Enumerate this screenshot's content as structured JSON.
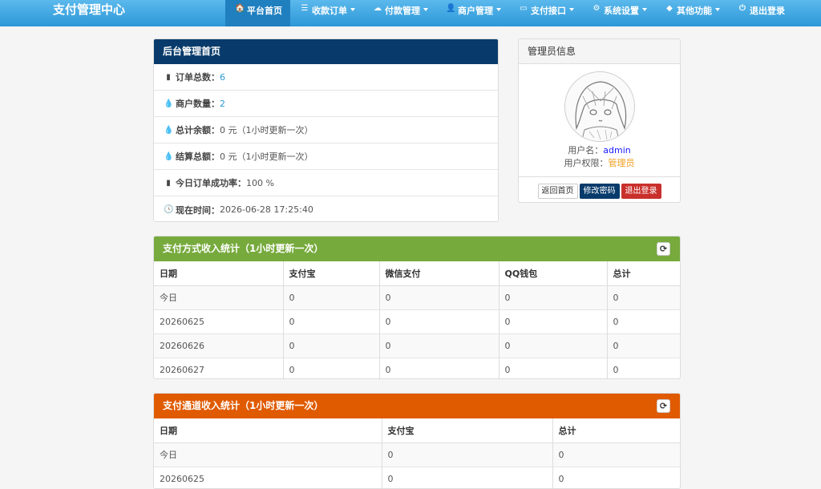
{
  "brand": "支付管理中心",
  "nav": [
    {
      "icon": "home-icon",
      "glyph": "🏠",
      "label": "平台首页",
      "active": true,
      "caret": false
    },
    {
      "icon": "list-icon",
      "glyph": "☰",
      "label": "收款订单",
      "caret": true
    },
    {
      "icon": "cloud-icon",
      "glyph": "☁",
      "label": "付款管理",
      "caret": true
    },
    {
      "icon": "user-icon",
      "glyph": "👤",
      "label": "商户管理",
      "caret": true
    },
    {
      "icon": "card-icon",
      "glyph": "▭",
      "label": "支付接口",
      "caret": true
    },
    {
      "icon": "gear-icon",
      "glyph": "⚙",
      "label": "系统设置",
      "caret": true
    },
    {
      "icon": "cube-icon",
      "glyph": "◆",
      "label": "其他功能",
      "caret": true
    },
    {
      "icon": "power-icon",
      "glyph": "⏻",
      "label": "退出登录",
      "caret": false
    }
  ],
  "dashboard": {
    "title": "后台管理首页",
    "items": [
      {
        "icon": "bar-chart-icon",
        "glyph": "▮",
        "label": "订单总数：",
        "value": "6",
        "style": "blue"
      },
      {
        "icon": "drop-icon",
        "glyph": "💧",
        "label": "商户数量：",
        "value": "2",
        "style": "blue"
      },
      {
        "icon": "drop-icon",
        "glyph": "💧",
        "label": "总计余额：",
        "value": "0 元（1小时更新一次）",
        "style": "plain"
      },
      {
        "icon": "drop-icon",
        "glyph": "💧",
        "label": "结算总额：",
        "value": "0 元（1小时更新一次）",
        "style": "plain"
      },
      {
        "icon": "bar-chart-icon",
        "glyph": "▮",
        "label": "今日订单成功率：",
        "value": "100 %",
        "style": "plain"
      },
      {
        "icon": "clock-icon",
        "glyph": "🕓",
        "label": "现在时间：",
        "value": " 2026-06-28 17:25:40",
        "style": "plain"
      }
    ]
  },
  "admin": {
    "title": "管理员信息",
    "username_label": "用户名：",
    "username": "admin",
    "role_label": "用户权限：",
    "role": "管理员",
    "btn_home": "返回首页",
    "btn_password": "修改密码",
    "btn_logout": "退出登录"
  },
  "paytype_stats": {
    "title": "支付方式收入统计（1小时更新一次）",
    "columns": [
      "日期",
      "支付宝",
      "微信支付",
      "QQ钱包",
      "总计"
    ],
    "rows": [
      [
        "今日",
        "0",
        "0",
        "0",
        "0"
      ],
      [
        "20260625",
        "0",
        "0",
        "0",
        "0"
      ],
      [
        "20260626",
        "0",
        "0",
        "0",
        "0"
      ],
      [
        "20260627",
        "0",
        "0",
        "0",
        "0"
      ]
    ]
  },
  "channel_stats": {
    "title": "支付通道收入统计（1小时更新一次）",
    "columns": [
      "日期",
      "支付宝",
      "总计"
    ],
    "rows": [
      [
        "今日",
        "0",
        "0"
      ],
      [
        "20260625",
        "0",
        "0"
      ]
    ]
  },
  "colors": {
    "nav": "#2d98d8",
    "dark": "#083b6b",
    "green": "#77aa3d",
    "orange": "#e05a00"
  }
}
